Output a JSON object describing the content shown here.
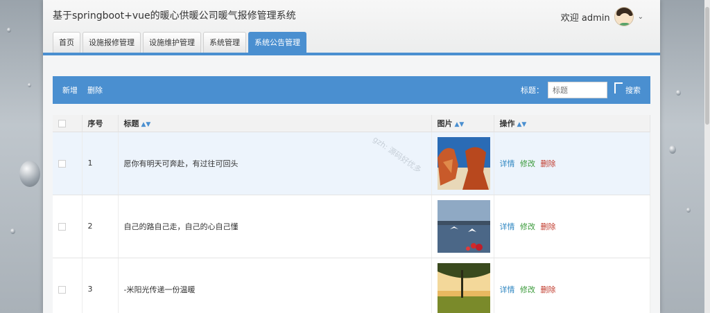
{
  "header": {
    "title": "基于springboot+vue的暖心供暖公司暖气报修管理系统",
    "welcome": "欢迎 admin"
  },
  "tabs": [
    {
      "label": "首页"
    },
    {
      "label": "设施报修管理"
    },
    {
      "label": "设施维护管理"
    },
    {
      "label": "系统管理"
    },
    {
      "label": "系统公告管理",
      "active": true
    }
  ],
  "toolbar": {
    "add_label": "新增",
    "delete_label": "删除",
    "search_label": "标题：",
    "search_placeholder": "标题",
    "search_button": "搜索"
  },
  "table": {
    "columns": [
      "序号",
      "标题",
      "图片",
      "操作"
    ],
    "rows": [
      {
        "index": "1",
        "title": "愿你有明天可奔赴，有过往可回头",
        "image": "red-rock-icon"
      },
      {
        "index": "2",
        "title": "自己的路自己走，自己的心自己懂",
        "image": "lake-gulls-icon"
      },
      {
        "index": "3",
        "title": "-米阳光传递一份温暖",
        "image": "field-sunset-icon"
      }
    ],
    "actions": {
      "detail": "详情",
      "edit": "修改",
      "delete": "删除"
    }
  },
  "watermark": "gzh: 源码好优多",
  "colors": {
    "accent": "#4a8fd0",
    "detail": "#2e86c1",
    "edit": "#3a9a3a",
    "delete": "#c0392b"
  }
}
